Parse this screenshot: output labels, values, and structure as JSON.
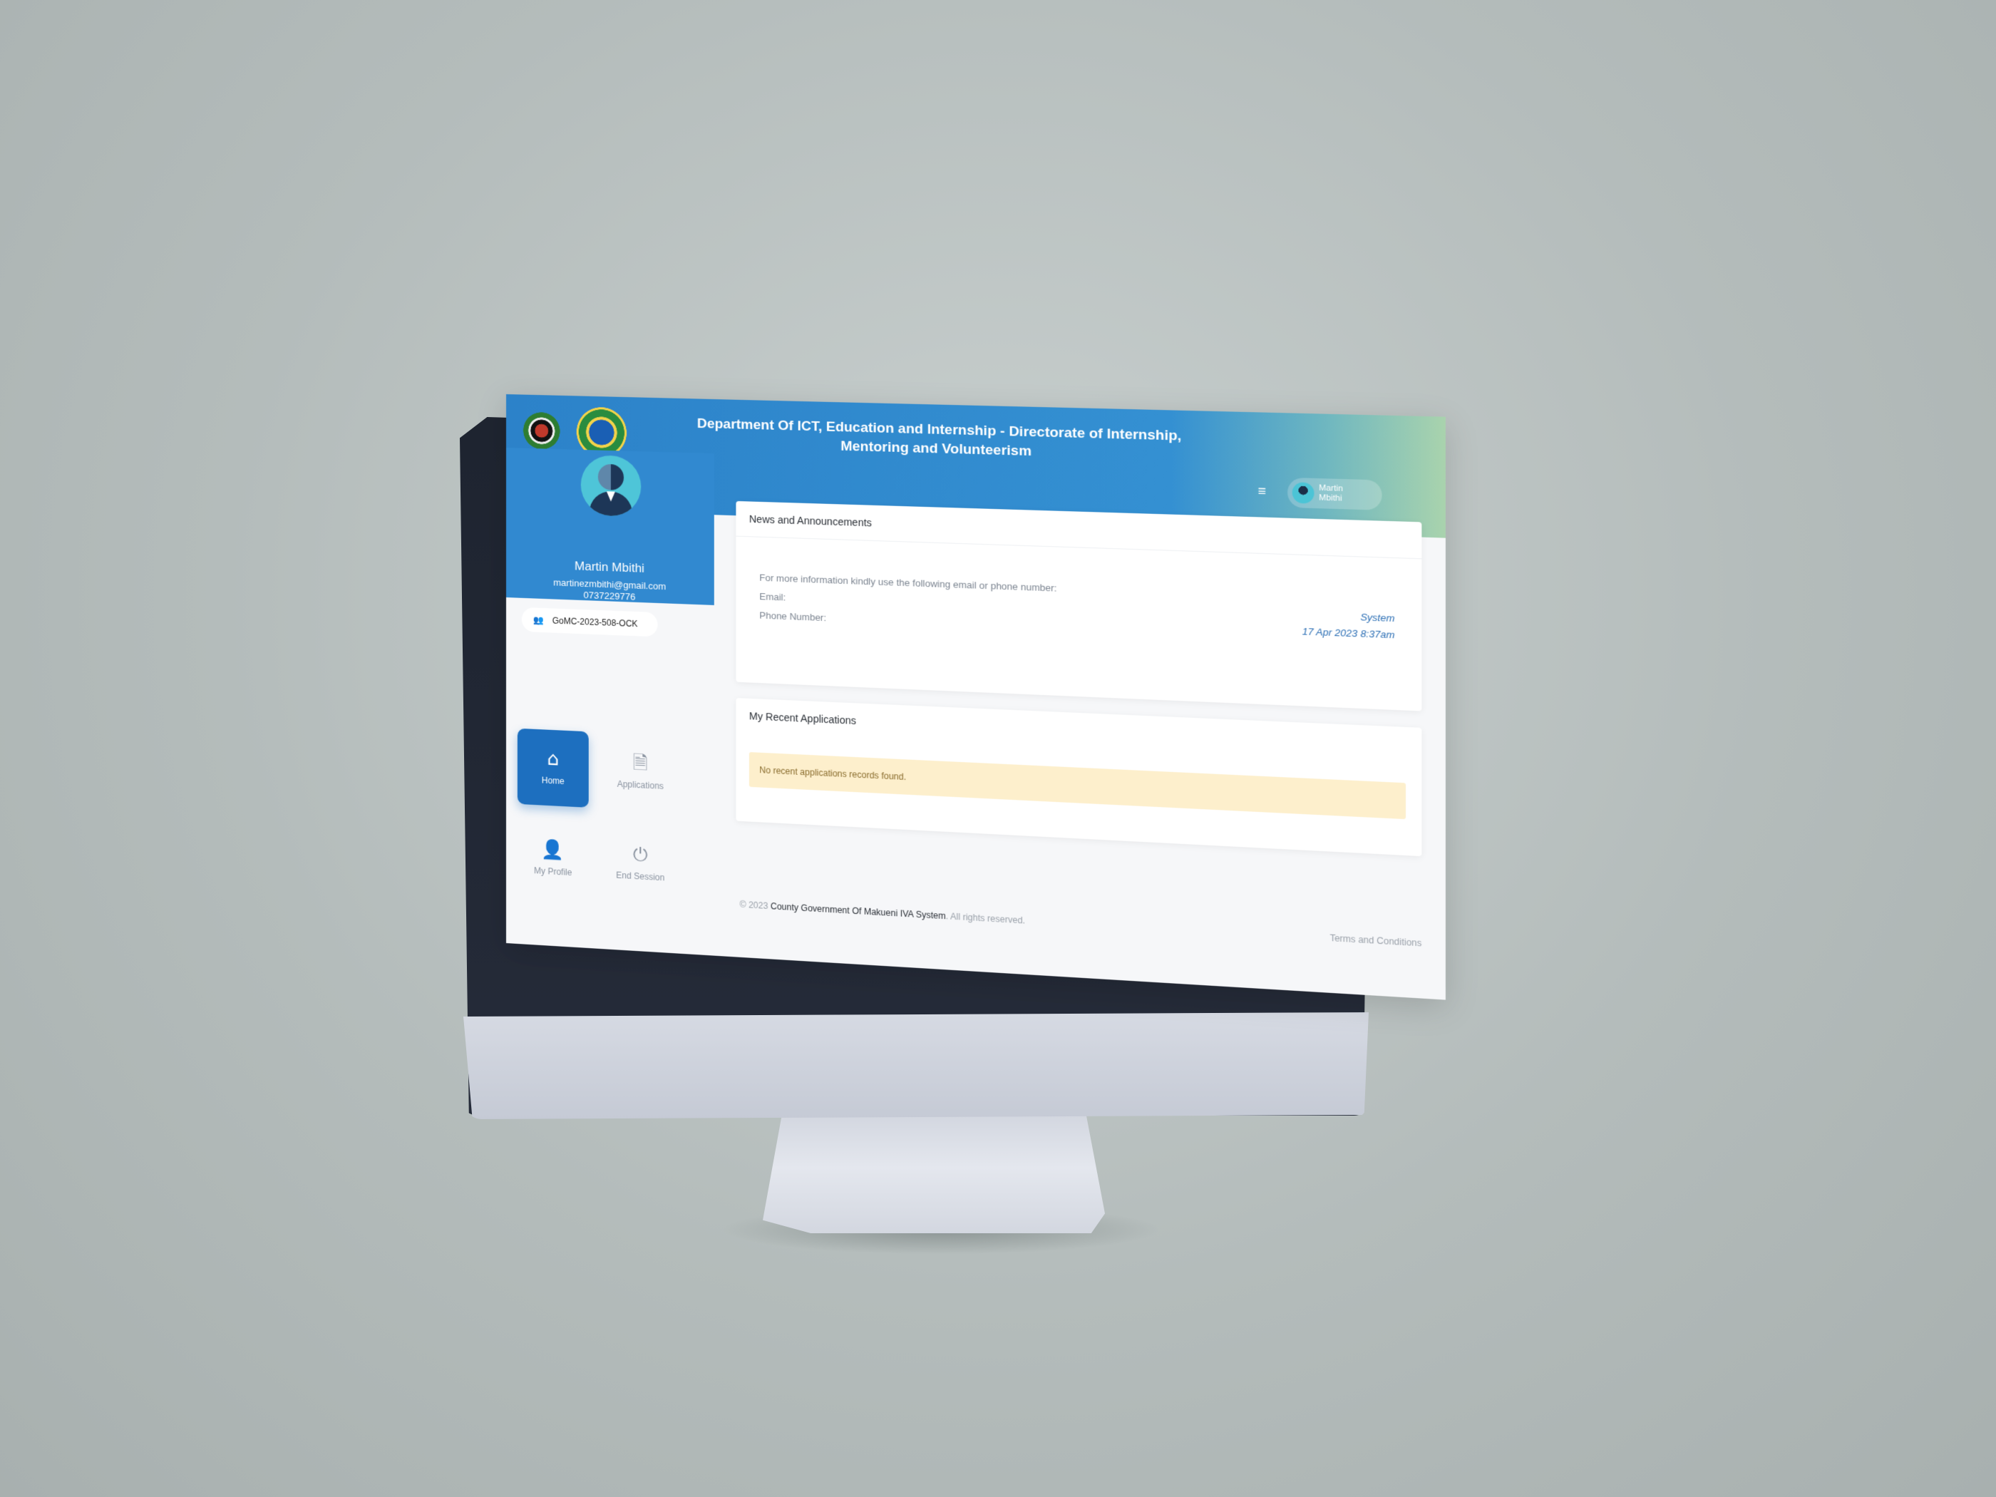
{
  "header": {
    "title": "Department Of ICT, Education and Internship - Directorate of Internship, Mentoring and Volunteerism",
    "user_name": "Martin Mbithi",
    "menu_icon": "hamburger-icon",
    "brand_color": "#2c82c9"
  },
  "profile": {
    "name": "Martin Mbithi",
    "email": "martinezmbithi@gmail.com",
    "phone": "0737229776",
    "id_code": "GoMC-2023-508-OCK"
  },
  "nav": {
    "home": {
      "label": "Home",
      "icon": "home-icon"
    },
    "applications": {
      "label": "Applications",
      "icon": "document-icon"
    },
    "my_profile": {
      "label": "My Profile",
      "icon": "user-edit-icon"
    },
    "end_session": {
      "label": "End Session",
      "icon": "power-icon"
    },
    "active_color": "#1d6fbf"
  },
  "news": {
    "title": "News and Announcements",
    "info_text": "For more information kindly use the following email or phone number:",
    "email_label": "Email:",
    "phone_label": "Phone Number:",
    "author": "System",
    "date": "17 Apr 2023 8:37am"
  },
  "recent_applications": {
    "title": "My Recent Applications",
    "empty_message": "No recent applications records found."
  },
  "footer": {
    "copyright_prefix": "© 2023",
    "organization": "County Government Of Makueni IVA System",
    "rights": ". All rights reserved.",
    "terms": "Terms and Conditions"
  }
}
